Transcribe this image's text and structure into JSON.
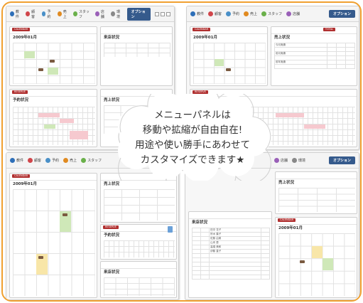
{
  "nav": {
    "items": [
      {
        "label": "教件",
        "icon": "home-icon",
        "color": "#2e6fb8"
      },
      {
        "label": "顧客",
        "icon": "heart-icon",
        "color": "#d0454a"
      },
      {
        "label": "予約",
        "icon": "calendar-icon",
        "color": "#4a90c8"
      },
      {
        "label": "売上",
        "icon": "yen-icon",
        "color": "#e08a20"
      },
      {
        "label": "スタッフ",
        "icon": "staff-icon",
        "color": "#6ab04a"
      },
      {
        "label": "店舗",
        "icon": "shop-icon",
        "color": "#9a60b8"
      },
      {
        "label": "環境",
        "icon": "settings-icon",
        "color": "#888888"
      }
    ],
    "options_label": "オプション"
  },
  "panels": {
    "calendar_tab": "CALENDAR",
    "calendar_month": "2009年01月",
    "sales_tab": "TOTAL",
    "sales_title": "売上状況",
    "reserve_tab": "RESERVE",
    "reserve_title": "予約状況",
    "shop_title": "来店状況",
    "sales_rows": [
      "今月実績",
      "前月実績",
      "前年実績"
    ],
    "staff_names": [
      "田中 花子",
      "鈴木 葉子",
      "佐藤 由美",
      "山本 恵",
      "高橋 美和",
      "伊藤 直子"
    ]
  },
  "callout": {
    "line1": "メニューパネルは",
    "line2": "移動や拡縮が自由自在!",
    "line3": "用途や使い勝手にあわせて",
    "line4": "カスタマイズできます★"
  },
  "colors": {
    "frame": "#f0a030",
    "accent_tab": "#b03030",
    "options_button": "#355a8c",
    "highlight_green": "#cfe8b8",
    "highlight_pink": "#f6c9cf"
  }
}
